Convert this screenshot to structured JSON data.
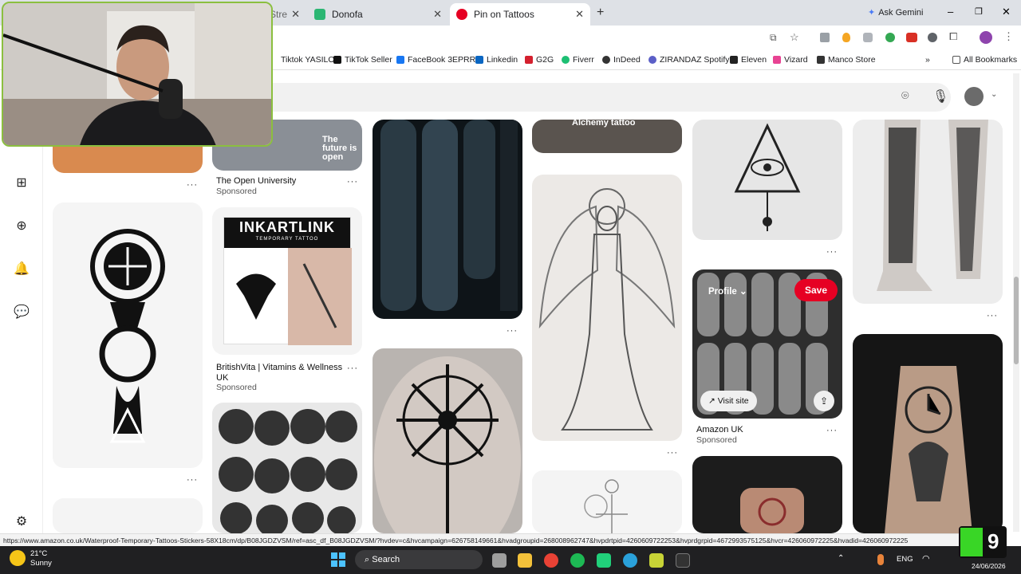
{
  "browser": {
    "tabs": [
      {
        "label": "Stre",
        "icon": "tab-icon"
      },
      {
        "label": "Donofa",
        "icon": "donofa-icon"
      },
      {
        "label": "Pin on Tattoos",
        "icon": "pinterest-icon"
      }
    ],
    "ask_gemini": "Ask Gemini",
    "bookmarks": [
      "Tiktok YASILO",
      "TikTok Seller",
      "FaceBook 3EPRRR",
      "Linkedin",
      "G2G",
      "Fiverr",
      "InDeed",
      "ZIRANDAZ Spotify",
      "Eleven",
      "Vizard",
      "Manco Store"
    ],
    "all_bookmarks": "All Bookmarks"
  },
  "pins": {
    "open_university": {
      "title": "The Open University",
      "sponsored": "Sponsored",
      "overlay": "The future is open"
    },
    "inkartlink": {
      "brand": "INKARTLINK",
      "sub": "TEMPORARY    TATTOO",
      "title": "BritishVita | Vitamins & Wellness UK",
      "sponsored": "Sponsored"
    },
    "alchemy": {
      "overlay": "Alchemy tattoo"
    },
    "amazon": {
      "title": "Amazon UK",
      "sponsored": "Sponsored",
      "profile": "Profile",
      "save": "Save",
      "visit": "Visit site"
    }
  },
  "status_url": "https://www.amazon.co.uk/Waterproof-Temporary-Tattoos-Stickers-58X18cm/dp/B08JGDZVSM/ref=asc_df_B08JGDZVSM/?hvdev=c&hvcampaign=626758149661&hvadgroupid=268008962747&hvpdrtpid=4260609722253&hvprdgrpid=4672993575125&hvcr=426060972225&hvadid=426060972225",
  "taskbar": {
    "temp": "21°C",
    "weather": "Sunny",
    "search": "Search",
    "lang": "ENG",
    "date": "24/06/2026"
  },
  "watermark": {
    "text": "9"
  },
  "colors": {
    "save": "#e60023",
    "tabstrip": "#dee1e6",
    "taskbar": "#202022"
  }
}
